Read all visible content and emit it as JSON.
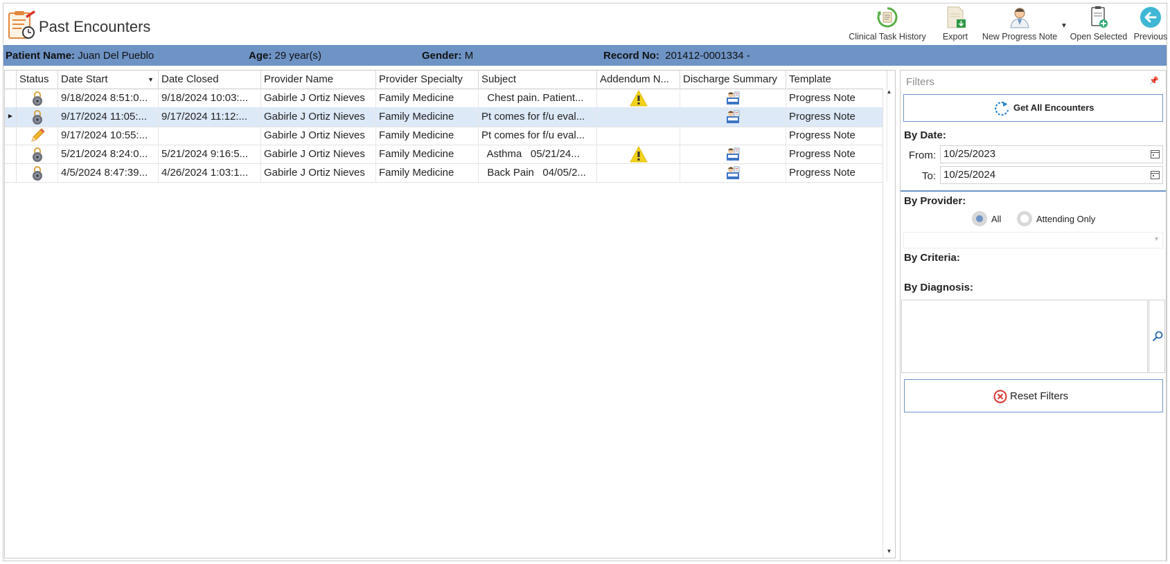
{
  "window": {
    "title": "Past Encounters"
  },
  "toolbar": {
    "clinical_task_history": "Clinical Task History",
    "export": "Export",
    "new_progress_note": "New Progress Note",
    "open_selected": "Open Selected",
    "previous": "Previous"
  },
  "patient": {
    "name_label": "Patient Name:",
    "name": "Juan Del Pueblo",
    "age_label": "Age:",
    "age": "29 year(s)",
    "gender_label": "Gender:",
    "gender": "M",
    "record_label": "Record No:",
    "record": "201412-0001334 -"
  },
  "grid": {
    "columns": [
      "Status",
      "Date Start",
      "Date Closed",
      "Provider Name",
      "Provider Specialty",
      "Subject",
      "Addendum N...",
      "Discharge Summary",
      "Template"
    ],
    "rows": [
      {
        "status_icon": "lock-icon",
        "date_start": "9/18/2024 8:51:0...",
        "date_closed": "9/18/2024 10:03:...",
        "provider": "Gabirle J Ortiz Nieves",
        "specialty": "Family Medicine",
        "subject": "  Chest pain. Patient...",
        "addendum_icon": "warning-icon",
        "discharge_icon": "discharge-summary-icon",
        "template": "Progress Note"
      },
      {
        "status_icon": "lock-icon",
        "date_start": "9/17/2024 11:05:...",
        "date_closed": "9/17/2024 11:12:...",
        "provider": "Gabirle J Ortiz Nieves",
        "specialty": "Family Medicine",
        "subject": "Pt comes for f/u eval...",
        "addendum_icon": "",
        "discharge_icon": "discharge-summary-icon",
        "template": "Progress Note"
      },
      {
        "status_icon": "pencil-icon",
        "date_start": "9/17/2024 10:55:...",
        "date_closed": "",
        "provider": "Gabirle J Ortiz Nieves",
        "specialty": "Family Medicine",
        "subject": "Pt comes for f/u eval...",
        "addendum_icon": "",
        "discharge_icon": "",
        "template": "Progress Note"
      },
      {
        "status_icon": "lock-icon",
        "date_start": "5/21/2024 8:24:0...",
        "date_closed": "5/21/2024 9:16:5...",
        "provider": "Gabirle J Ortiz Nieves",
        "specialty": "Family Medicine",
        "subject": "  Asthma   05/21/24...",
        "addendum_icon": "warning-icon",
        "discharge_icon": "discharge-summary-icon",
        "template": "Progress Note"
      },
      {
        "status_icon": "lock-icon",
        "date_start": "4/5/2024 8:47:39...",
        "date_closed": "4/26/2024 1:03:1...",
        "provider": "Gabirle J Ortiz Nieves",
        "specialty": "Family Medicine",
        "subject": "  Back Pain   04/05/2...",
        "addendum_icon": "",
        "discharge_icon": "discharge-summary-icon",
        "template": "Progress Note"
      }
    ],
    "selected_row": 1
  },
  "filters": {
    "title": "Filters",
    "get_all": "Get All Encounters",
    "by_date": "By Date:",
    "from_label": "From:",
    "from_value": "10/25/2023",
    "to_label": "To:",
    "to_value": "10/25/2024",
    "by_provider": "By Provider:",
    "radio_all": "All",
    "radio_attending": "Attending Only",
    "selected_provider_option": "All",
    "by_criteria": "By Criteria:",
    "by_diagnosis": "By Diagnosis:",
    "reset": "Reset Filters"
  },
  "colors": {
    "accent": "#6e94c6",
    "selected_row": "#dde9f7",
    "warning": "#f2d21b",
    "reset_red": "#d9342b"
  }
}
